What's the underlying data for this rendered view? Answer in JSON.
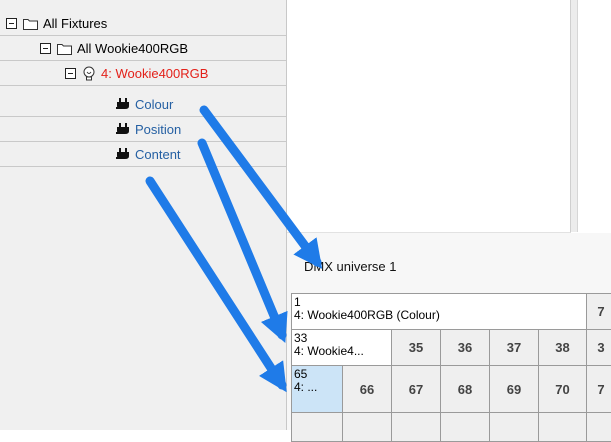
{
  "tree": {
    "items": [
      {
        "label": "All Fixtures"
      },
      {
        "label": "All Wookie400RGB"
      },
      {
        "label": "4: Wookie400RGB",
        "color": "#e3211a"
      },
      {
        "label": "Colour",
        "color": "#2560a3"
      },
      {
        "label": "Position",
        "color": "#2560a3"
      },
      {
        "label": "Content",
        "color": "#2560a3"
      }
    ]
  },
  "dmx": {
    "title": "DMX universe 1",
    "cells": {
      "c1_num": "1",
      "c1_name": "4: Wookie400RGB (Colour)",
      "c7": "7",
      "c33_num": "33",
      "c33_name": "4: Wookie4...",
      "c35": "35",
      "c36": "36",
      "c37": "37",
      "c38": "38",
      "c39": "3",
      "c65_num": "65",
      "c65_name": "4: ...",
      "c66": "66",
      "c67": "67",
      "c68": "68",
      "c69": "69",
      "c70": "70",
      "c71": "7"
    }
  },
  "colors": {
    "arrow": "#1f7be8",
    "selected_cell": "#cce4f7"
  },
  "icons": [
    "expander-minus-icon",
    "folder-icon",
    "bulb-icon",
    "plug-icon"
  ]
}
